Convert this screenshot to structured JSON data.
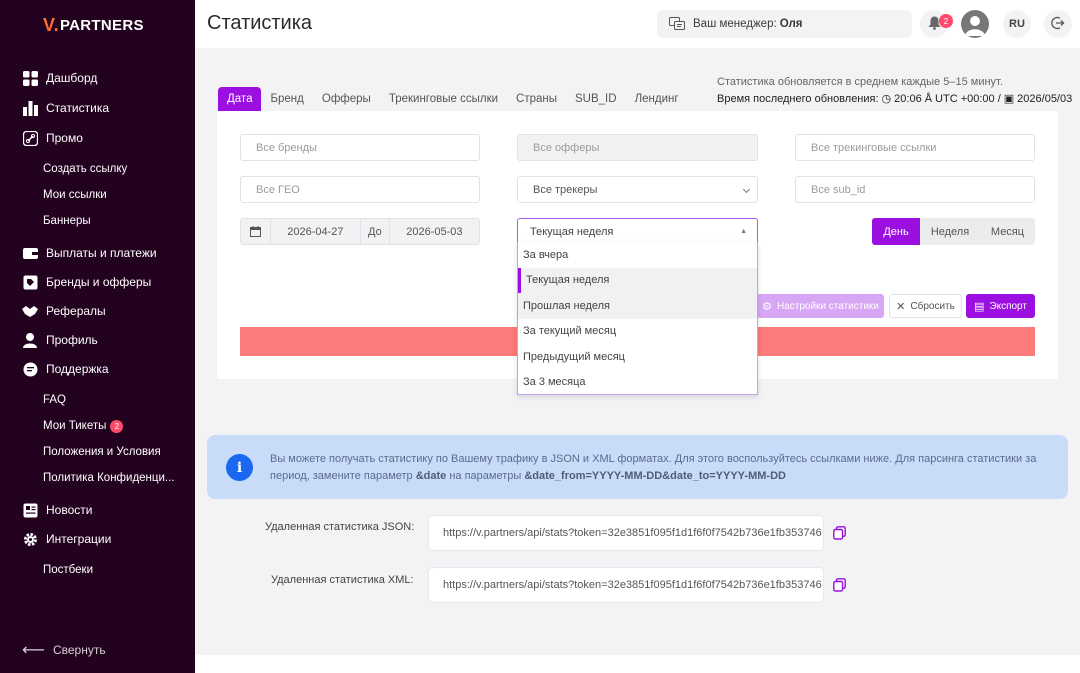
{
  "brand": {
    "name": "PARTNERS",
    "letter": "V.",
    "accent": "#ff6b2c"
  },
  "sidebar": {
    "items": [
      {
        "label": "Дашборд",
        "icon": "dashboard-icon"
      },
      {
        "label": "Статистика",
        "icon": "bar-chart-icon"
      },
      {
        "label": "Промо",
        "icon": "link-icon"
      },
      {
        "label": "Выплаты и платежи",
        "icon": "wallet-icon"
      },
      {
        "label": "Бренды и офферы",
        "icon": "tag-icon"
      },
      {
        "label": "Рефералы",
        "icon": "handshake-icon"
      },
      {
        "label": "Профиль",
        "icon": "user-icon"
      },
      {
        "label": "Поддержка",
        "icon": "chat-icon"
      },
      {
        "label": "Новости",
        "icon": "news-icon"
      },
      {
        "label": "Интеграции",
        "icon": "gear-icon"
      }
    ],
    "promo_sub": [
      "Создать ссылку",
      "Мои ссылки",
      "Баннеры"
    ],
    "support_sub": [
      "FAQ",
      "Мои Тикеты",
      "Положения и Условия",
      "Политика Конфиденци..."
    ],
    "tickets_count": "2",
    "integrations_sub": [
      "Постбеки"
    ],
    "collapse_label": "Свернуть"
  },
  "header": {
    "title": "Статистика",
    "manager_prefix": "Ваш менеджер:",
    "manager_name": "Оля",
    "notifications_count": "2",
    "language": "RU"
  },
  "tabs": [
    "Дата",
    "Бренд",
    "Офферы",
    "Трекинговые ссылки",
    "Страны",
    "SUB_ID",
    "Лендинг"
  ],
  "update": {
    "note": "Статистика обновляется в среднем каждые 5–15 минут.",
    "label": "Время последнего обновления:",
    "time": "20:06",
    "tz": "UTC +00:00 /",
    "date": "2026/05/03"
  },
  "filters": {
    "brands": "Все бренды",
    "offers": "Все офферы",
    "tracking": "Все трекинговые ссылки",
    "geo": "Все ГЕО",
    "trackers": "Все трекеры",
    "sub_id": "Все sub_id",
    "date_from": "2026-04-27",
    "to": "До",
    "date_to": "2026-05-03",
    "period": "Текущая неделя",
    "period_options": [
      "За вчера",
      "Текущая неделя",
      "Прошлая неделя",
      "За текущий месяц",
      "Предыдущий месяц",
      "За 3 месяца"
    ],
    "granularity": [
      "День",
      "Неделя",
      "Месяц"
    ]
  },
  "actions": {
    "settings": "Настройки статистики",
    "reset": "Сбросить",
    "export": "Экспорт"
  },
  "info": {
    "text_1": "Вы можете получать статистику по Вашему трафику в JSON и XML форматах. Для этого воспользуйтесь ссылками ниже. Для парсинга статистики за период, замените параметр ",
    "param_1": "&date",
    "text_2": " на параметры ",
    "param_2": "&date_from=YYYY-MM-DD&date_to=YYYY-MM-DD"
  },
  "remote": {
    "json_label": "Удаленная статистика JSON:",
    "json_url": "https://v.partners/api/stats?token=32e3851f095f1d1f6f0f7542b736e1fb353746",
    "xml_label": "Удаленная статистика XML:",
    "xml_url": "https://v.partners/api/stats?token=32e3851f095f1d1f6f0f7542b736e1fb353746"
  },
  "colors": {
    "accent": "#9b0fe0",
    "sidebar_bg": "#22021f",
    "error_bar": "#fa7b79",
    "info_bg": "#c8dcfa"
  }
}
